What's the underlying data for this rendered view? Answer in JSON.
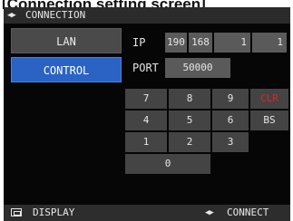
{
  "caption": "[Connection setting screen]",
  "titlebar": {
    "title": "CONNECTION"
  },
  "sidebar": {
    "lan_label": "LAN",
    "control_label": "CONTROL"
  },
  "ip": {
    "label": "IP",
    "octets": [
      "190",
      "168",
      "1",
      "1"
    ]
  },
  "port": {
    "label": "PORT",
    "value": "50000"
  },
  "keypad": {
    "keys": [
      "7",
      "8",
      "9",
      "CLR",
      "4",
      "5",
      "6",
      "BS",
      "1",
      "2",
      "3",
      "0"
    ]
  },
  "footer": {
    "display_label": "DISPLAY",
    "connect_label": "CONNECT"
  },
  "colors": {
    "selected": "#2a63c4",
    "clear_key": "#e02424",
    "screen_bg": "#060606"
  }
}
